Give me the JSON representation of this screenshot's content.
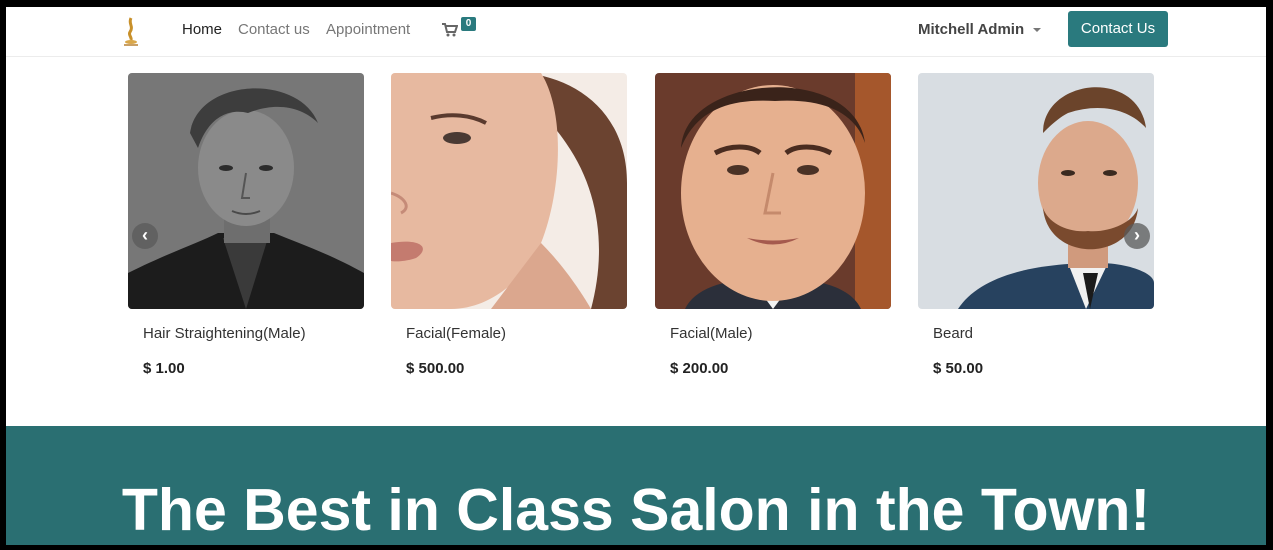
{
  "nav": {
    "items": [
      {
        "label": "Home",
        "active": true
      },
      {
        "label": "Contact us",
        "active": false
      },
      {
        "label": "Appointment",
        "active": false
      }
    ],
    "cart_count": "0",
    "user_name": "Mitchell Admin",
    "cta_label": "Contact Us"
  },
  "products": [
    {
      "name": "Hair Straightening(Male)",
      "price": "$ 1.00"
    },
    {
      "name": "Facial(Female)",
      "price": "$ 500.00"
    },
    {
      "name": "Facial(Male)",
      "price": "$ 200.00"
    },
    {
      "name": "Beard",
      "price": "$ 50.00"
    }
  ],
  "carousel": {
    "prev_icon": "chevron-left-icon",
    "next_icon": "chevron-right-icon"
  },
  "banner": {
    "title": "The Best in Class Salon in the Town!"
  },
  "colors": {
    "accent": "#2a7a7e",
    "banner": "#2a6f72"
  }
}
